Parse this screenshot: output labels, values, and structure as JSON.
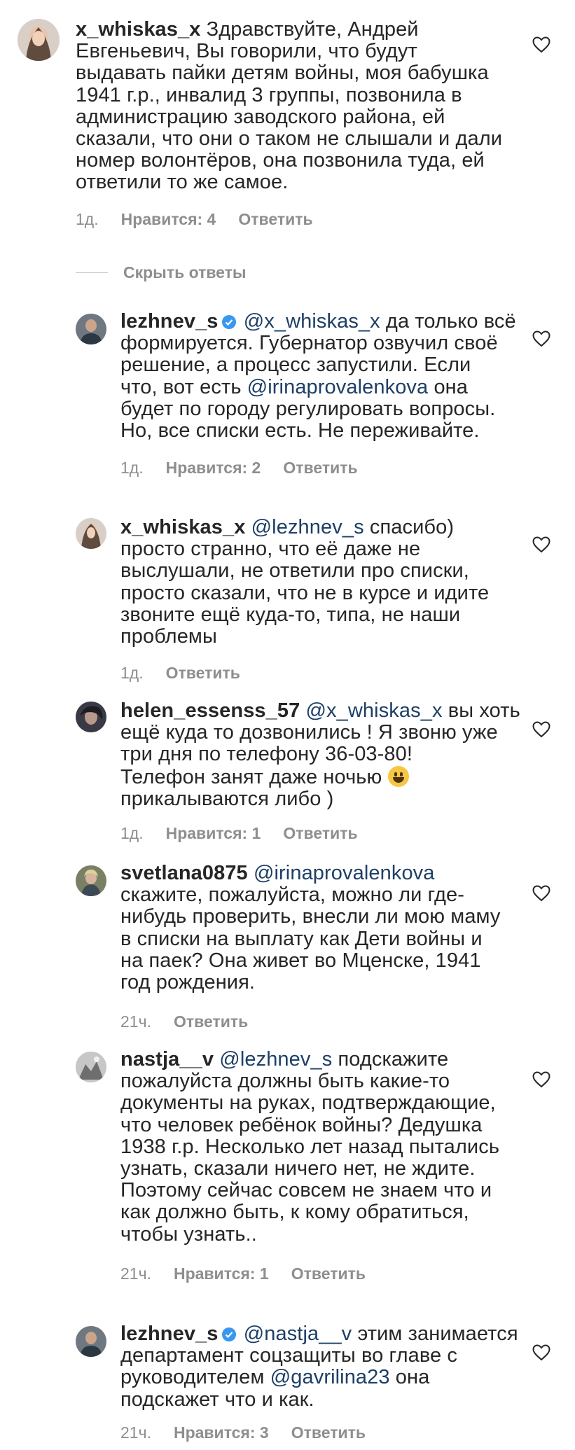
{
  "hide_replies": "Скрыть ответы",
  "verified_icon": "verified-badge-icon",
  "colors": {
    "mention": "#1d3f66",
    "meta": "#8e8e8e",
    "verified": "#3897f0"
  },
  "comments": [
    {
      "username": "x_whiskas_x",
      "verified": false,
      "lines": [
        "Здравствуйте, Андрей",
        "Евгеньевич, Вы говорили, что будут",
        "выдавать пайки детям войны, моя бабушка",
        "1941 г.р., инвалид 3 группы, позвонила в",
        "администрацию заводского района, ей",
        "сказали, что они о таком не слышали и дали",
        "номер волонтёров, она позвонила туда, ей",
        "ответили то же самое."
      ],
      "time": "1д.",
      "likes": "Нравится: 4",
      "reply": "Ответить"
    },
    {
      "username": "lezhnev_s",
      "verified": true,
      "mention": "@x_whiskas_x",
      "lines": [
        "да только всё",
        "формируется. Губернатор озвучил своё",
        "решение, а процесс запустили. Если",
        "что, вот есть",
        "будет по городу регулировать вопросы.",
        "Но, все списки есть. Не переживайте."
      ],
      "inline_mention": "@irinaprovalenkova",
      "inline_after": "она",
      "time": "1д.",
      "likes": "Нравится: 2",
      "reply": "Ответить"
    },
    {
      "username": "x_whiskas_x",
      "verified": false,
      "mention": "@lezhnev_s",
      "lines": [
        "спасибо)",
        "просто странно, что её даже не",
        "выслушали, не ответили про списки,",
        "просто сказали, что не в курсе и идите",
        "звоните ещё куда-то, типа, не наши",
        "проблемы"
      ],
      "time": "1д.",
      "reply": "Ответить"
    },
    {
      "username": "helen_essenss_57",
      "verified": false,
      "mention": "@x_whiskas_x",
      "lines": [
        "вы хоть",
        "ещё куда то дозвонились ! Я звоню уже",
        "три дня по телефону 36-03-80!",
        "Телефон занят даже ночью",
        "прикалываются либо )"
      ],
      "time": "1д.",
      "likes": "Нравится: 1",
      "reply": "Ответить"
    },
    {
      "username": "svetlana0875",
      "verified": false,
      "mention": "@irinaprovalenkova",
      "lines": [
        "",
        "скажите, пожалуйста, можно ли где-",
        "нибудь проверить, внесли ли мою маму",
        "в списки на выплату как Дети войны и",
        "на паек? Она живет во Мценске, 1941",
        "год рождения."
      ],
      "time": "21ч.",
      "reply": "Ответить"
    },
    {
      "username": "nastja__v",
      "verified": false,
      "mention": "@lezhnev_s",
      "lines": [
        "подскажите",
        "пожалуйста должны быть какие-то",
        "документы на руках, подтверждающие,",
        "что человек ребёнок войны? Дедушка",
        "1938 г.р. Несколько лет назад пытались",
        "узнать, сказали ничего нет, не ждите.",
        "Поэтому сейчас совсем не знаем что и",
        "как должно быть, к кому обратиться,",
        "чтобы узнать.."
      ],
      "time": "21ч.",
      "likes": "Нравится: 1",
      "reply": "Ответить"
    },
    {
      "username": "lezhnev_s",
      "verified": true,
      "mention": "@nastja__v",
      "lines": [
        "этим занимается",
        "департамент соцзащиты во главе с",
        "руководителем",
        "подскажет что и как."
      ],
      "inline_mention": "@gavrilina23",
      "inline_after": "она",
      "time": "21ч.",
      "likes": "Нравится: 3",
      "reply": "Ответить"
    }
  ]
}
